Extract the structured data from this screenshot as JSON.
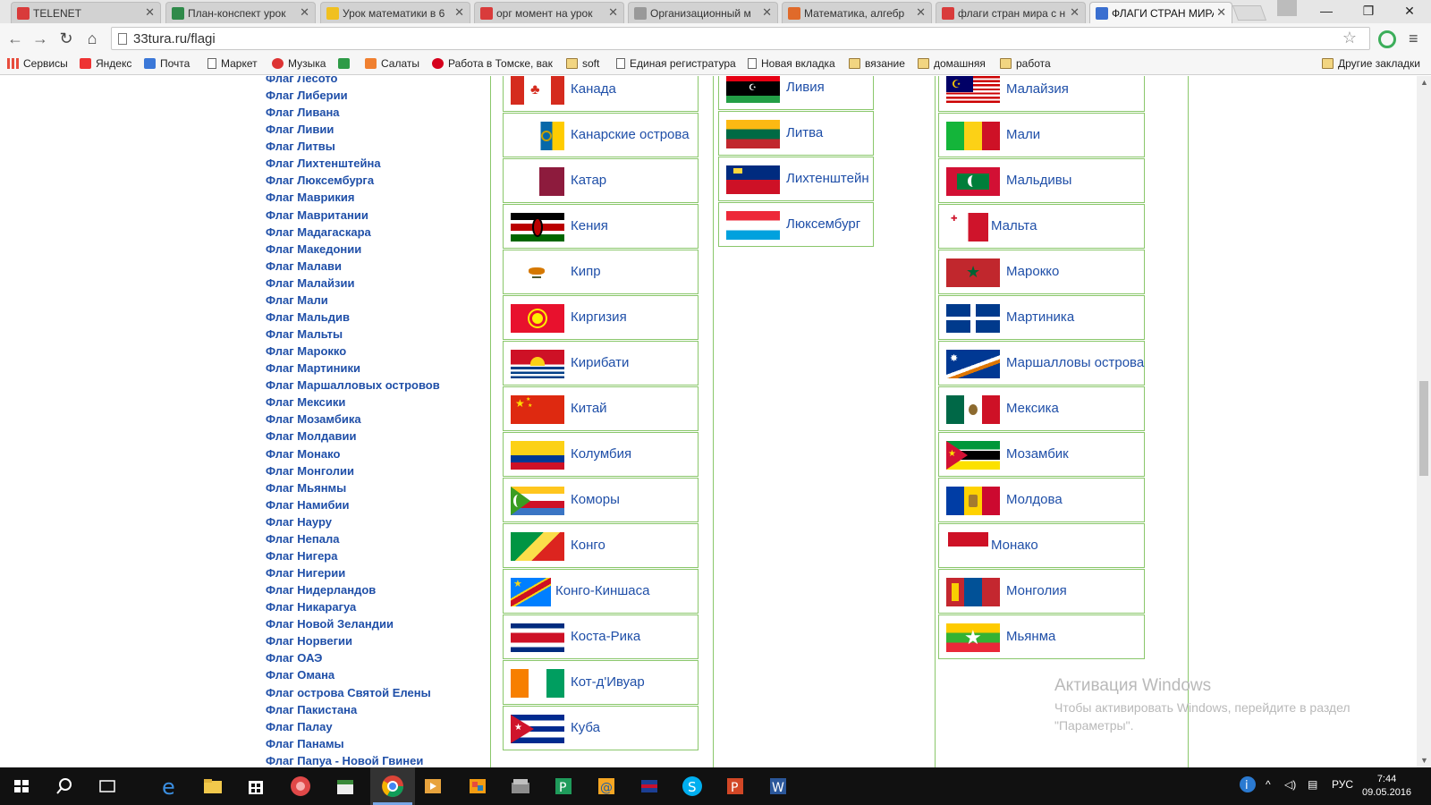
{
  "browser": {
    "tabs": [
      {
        "label": "TELENET",
        "icon_color": "#d93b3b",
        "active": false
      },
      {
        "label": "План-конспект урок",
        "icon_color": "#2f8a4a",
        "active": false
      },
      {
        "label": "Урок математики в 6",
        "icon_color": "#f0c020",
        "active": false
      },
      {
        "label": "орг момент на урок",
        "icon_color": "#d93b3b",
        "active": false
      },
      {
        "label": "Организационный м",
        "icon_color": "#999999",
        "active": false
      },
      {
        "label": "Математика, алгебр",
        "icon_color": "#e06a2a",
        "active": false
      },
      {
        "label": "флаги стран мира с н",
        "icon_color": "#d93b3b",
        "active": false
      },
      {
        "label": "ФЛАГИ СТРАН МИРА",
        "icon_color": "#3a6fd0",
        "active": true
      }
    ],
    "address": "33tura.ru/flagi",
    "window_controls": {
      "minimize": "—",
      "restore": "❐",
      "close": "✕"
    }
  },
  "bookmarks": [
    {
      "label": "Сервисы",
      "icon": "apps-icon"
    },
    {
      "label": "Яндекс",
      "icon": "yandex-icon"
    },
    {
      "label": "Почта",
      "icon": "mail-icon"
    },
    {
      "label": "Маркет",
      "icon": "page-icon"
    },
    {
      "label": "Музыка",
      "icon": "music-icon"
    },
    {
      "label": "",
      "icon": "puzzle-icon"
    },
    {
      "label": "Салаты",
      "icon": "seven-icon"
    },
    {
      "label": "Работа в Томске, вак",
      "icon": "hh-icon"
    },
    {
      "label": "soft",
      "icon": "folder-icon"
    },
    {
      "label": "Единая регистратура",
      "icon": "page-icon"
    },
    {
      "label": "Новая вкладка",
      "icon": "page-icon"
    },
    {
      "label": "вязание",
      "icon": "folder-icon"
    },
    {
      "label": "домашняя",
      "icon": "folder-icon"
    },
    {
      "label": "работа",
      "icon": "folder-icon"
    },
    {
      "label": "Другие закладки",
      "icon": "folder-icon"
    }
  ],
  "left_links": [
    "Флаг Лесото",
    "Флаг Либерии",
    "Флаг Ливана",
    "Флаг Ливии",
    "Флаг Литвы",
    "Флаг Лихтенштейна",
    "Флаг Люксембурга",
    "Флаг Маврикия",
    "Флаг Мавритании",
    "Флаг Мадагаскара",
    "Флаг Македонии",
    "Флаг Малави",
    "Флаг Малайзии",
    "Флаг Мали",
    "Флаг Мальдив",
    "Флаг Мальты",
    "Флаг Марокко",
    "Флаг Мартиники",
    "Флаг Маршалловых островов",
    "Флаг Мексики",
    "Флаг Мозамбика",
    "Флаг Молдавии",
    "Флаг Монако",
    "Флаг Монголии",
    "Флаг Мьянмы",
    "Флаг Намибии",
    "Флаг Науру",
    "Флаг Непала",
    "Флаг Нигера",
    "Флаг Нигерии",
    "Флаг Нидерландов",
    "Флаг Никарагуа",
    "Флаг Новой Зеландии",
    "Флаг Норвегии",
    "Флаг ОАЭ",
    "Флаг Омана",
    "Флаг острова Святой Елены",
    "Флаг Пакистана",
    "Флаг Палау",
    "Флаг Панамы",
    "Флаг Папуа - Новой Гвинеи"
  ],
  "column_k": [
    {
      "name": "Канада",
      "flag": "canada-flag"
    },
    {
      "name": "Канарские острова",
      "flag": "canary-islands-flag"
    },
    {
      "name": "Катар",
      "flag": "qatar-flag"
    },
    {
      "name": "Кения",
      "flag": "kenya-flag"
    },
    {
      "name": "Кипр",
      "flag": "cyprus-flag"
    },
    {
      "name": "Киргизия",
      "flag": "kyrgyzstan-flag"
    },
    {
      "name": "Кирибати",
      "flag": "kiribati-flag"
    },
    {
      "name": "Китай",
      "flag": "china-flag"
    },
    {
      "name": "Колумбия",
      "flag": "colombia-flag"
    },
    {
      "name": "Коморы",
      "flag": "comoros-flag"
    },
    {
      "name": "Конго",
      "flag": "congo-flag"
    },
    {
      "name": "Конго-Киншаса",
      "flag": "dr-congo-flag"
    },
    {
      "name": "Коста-Рика",
      "flag": "costa-rica-flag"
    },
    {
      "name": "Кот-д'Ивуар",
      "flag": "ivory-coast-flag"
    },
    {
      "name": "Куба",
      "flag": "cuba-flag"
    }
  ],
  "column_l": [
    {
      "name": "Ливия",
      "flag": "libya-flag"
    },
    {
      "name": "Литва",
      "flag": "lithuania-flag"
    },
    {
      "name": "Лихтенштейн",
      "flag": "liechtenstein-flag"
    },
    {
      "name": "Люксембург",
      "flag": "luxembourg-flag"
    }
  ],
  "column_m": [
    {
      "name": "Малайзия",
      "flag": "malaysia-flag"
    },
    {
      "name": "Мали",
      "flag": "mali-flag"
    },
    {
      "name": "Мальдивы",
      "flag": "maldives-flag"
    },
    {
      "name": "Мальта",
      "flag": "malta-flag"
    },
    {
      "name": "Марокко",
      "flag": "morocco-flag"
    },
    {
      "name": "Мартиника",
      "flag": "martinique-flag"
    },
    {
      "name": "Маршалловы острова",
      "flag": "marshall-islands-flag"
    },
    {
      "name": "Мексика",
      "flag": "mexico-flag"
    },
    {
      "name": "Мозамбик",
      "flag": "mozambique-flag"
    },
    {
      "name": "Молдова",
      "flag": "moldova-flag"
    },
    {
      "name": "Монако",
      "flag": "monaco-flag"
    },
    {
      "name": "Монголия",
      "flag": "mongolia-flag"
    },
    {
      "name": "Мьянма",
      "flag": "myanmar-flag"
    }
  ],
  "watermark": {
    "title": "Активация Windows",
    "line1": "Чтобы активировать Windows, перейдите в раздел",
    "line2": "\"Параметры\"."
  },
  "taskbar": {
    "language": "РУС",
    "time": "7:44",
    "date": "09.05.2016"
  }
}
